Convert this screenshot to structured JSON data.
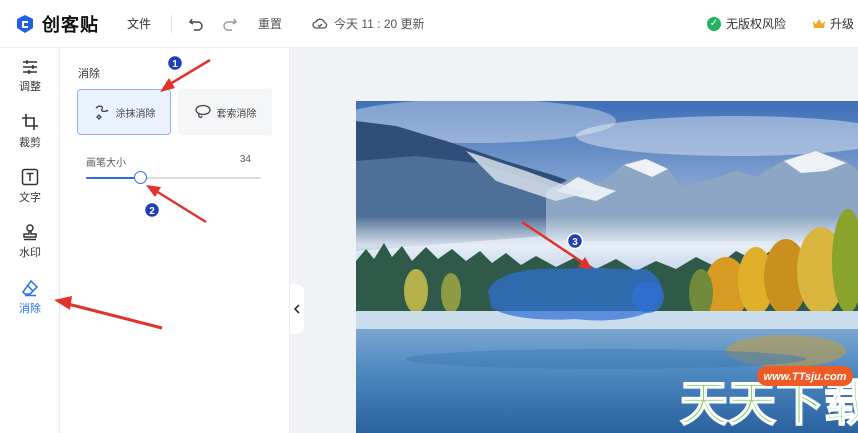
{
  "brand": {
    "name": "创客贴"
  },
  "header": {
    "file_menu": "文件",
    "reset_label": "重置",
    "save_status": "今天 11 : 20 更新",
    "copyright_status": "无版权风险",
    "upgrade_label": "升级"
  },
  "tools": [
    {
      "id": "adjust",
      "label": "调整",
      "icon": "sliders-icon"
    },
    {
      "id": "crop",
      "label": "裁剪",
      "icon": "crop-icon"
    },
    {
      "id": "text",
      "label": "文字",
      "icon": "text-icon"
    },
    {
      "id": "watermark",
      "label": "水印",
      "icon": "stamp-icon"
    },
    {
      "id": "erase",
      "label": "消除",
      "icon": "eraser-icon",
      "active": true
    }
  ],
  "panel": {
    "title": "消除",
    "modes": [
      {
        "label": "涂抹消除",
        "icon": "brush-smear-icon",
        "selected": true
      },
      {
        "label": "套索消除",
        "icon": "lasso-icon",
        "selected": false
      }
    ],
    "brush": {
      "label": "画笔大小",
      "value": "34",
      "fraction": 0.31
    }
  },
  "annotations": {
    "markers": [
      "1",
      "2",
      "3"
    ],
    "watermark_site": "www.TTsju.com",
    "watermark_title": "天天下载"
  },
  "colors": {
    "accent": "#2a6df4",
    "arrow": "#e3322b",
    "marker": "#1f3fb8",
    "brush_mask": "#2f6fd6"
  }
}
